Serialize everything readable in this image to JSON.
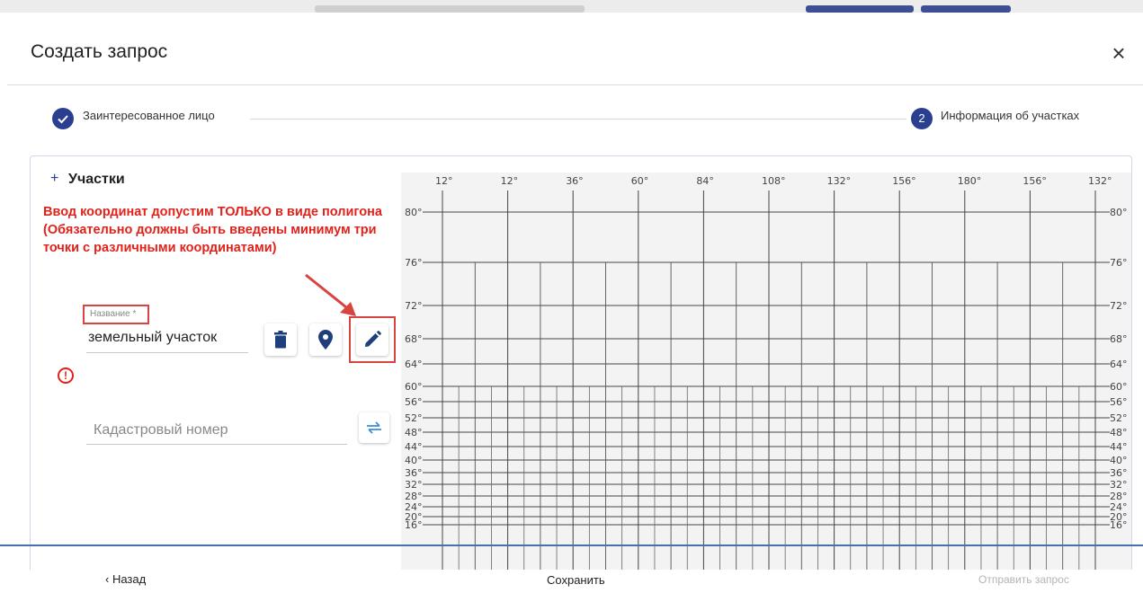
{
  "dialog": {
    "title": "Создать запрос",
    "close_symbol": "×"
  },
  "stepper": {
    "steps": [
      {
        "label": "Заинтересованное лицо",
        "state": "done",
        "icon": "check-icon"
      },
      {
        "label": "Информация об участках",
        "state": "active",
        "number": "2"
      }
    ]
  },
  "section": {
    "expand_symbol": "+",
    "title": "Участки"
  },
  "warning": "Ввод координат допустим ТОЛЬКО в виде полигона (Обязательно должны быть введены минимум три точки с различными координатами)",
  "name_field": {
    "label": "Название *",
    "value": "земельный участок"
  },
  "cadastral_field": {
    "placeholder": "Кадастровый номер"
  },
  "alert_symbol": "!",
  "map": {
    "top_labels": [
      "12°",
      "12°",
      "36°",
      "60°",
      "84°",
      "108°",
      "132°",
      "156°",
      "180°",
      "156°",
      "132°"
    ],
    "left_labels": [
      "80°",
      "76°",
      "72°",
      "68°",
      "64°",
      "60°",
      "56°",
      "52°",
      "48°",
      "44°",
      "40°",
      "36°",
      "32°",
      "28°",
      "24°",
      "20°",
      "16°"
    ]
  },
  "footer": {
    "back_label": "Назад",
    "save_label": "Сохранить",
    "send_label": "Отправить запрос"
  },
  "colors": {
    "accent": "#2a3f8f",
    "warning": "#e0221b",
    "annotation": "#d84540",
    "disabled": "#b4b4b4"
  }
}
